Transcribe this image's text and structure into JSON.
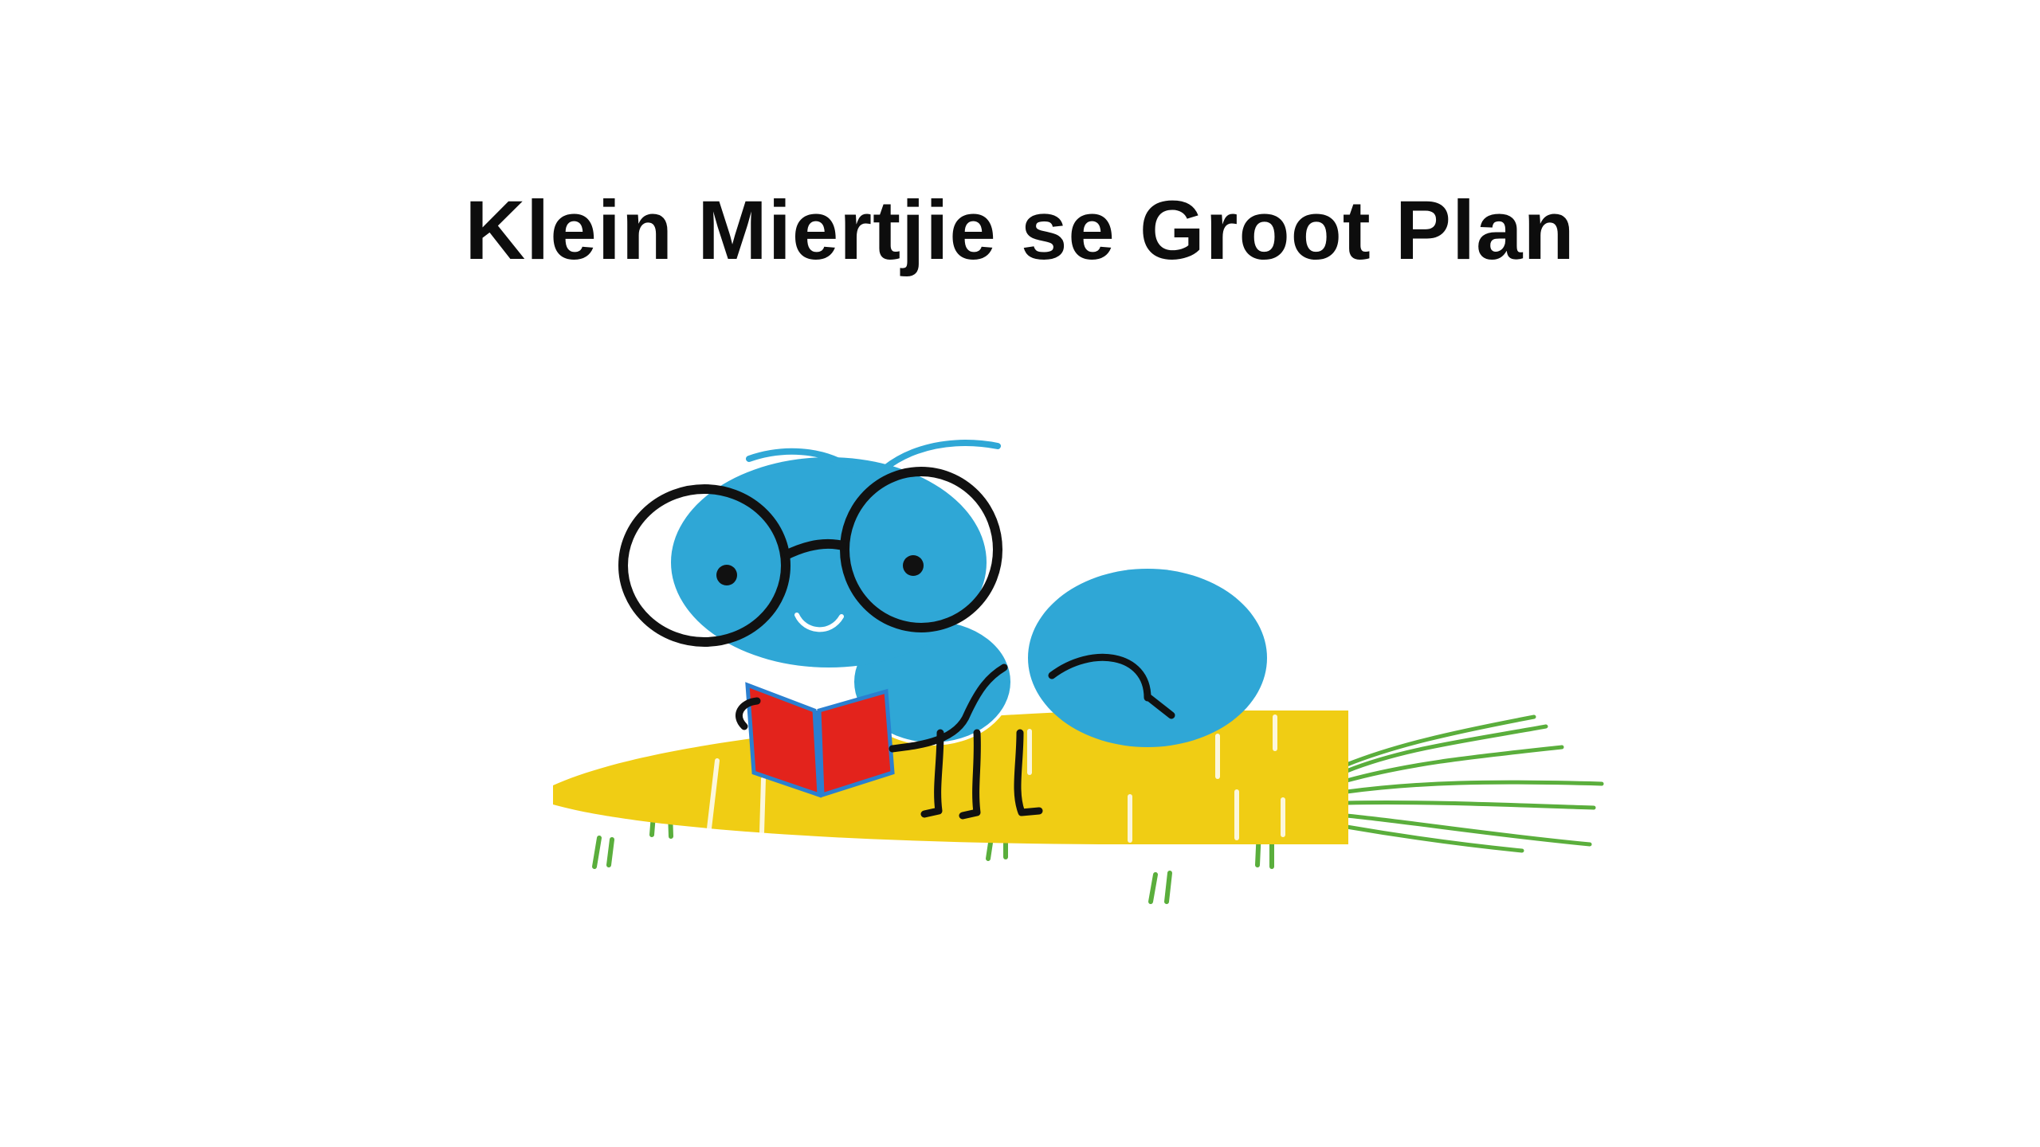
{
  "book": {
    "title": "Klein Miertjie se Groot Plan"
  },
  "illustration": {
    "subject": "ant-reading-on-carrot",
    "colors": {
      "ant_body": "#2fa7d6",
      "carrot": "#f0cd14",
      "carrot_top": "#5aae3c",
      "book_cover": "#e3231c",
      "book_spine": "#2a7fd0",
      "outline": "#111111"
    }
  }
}
